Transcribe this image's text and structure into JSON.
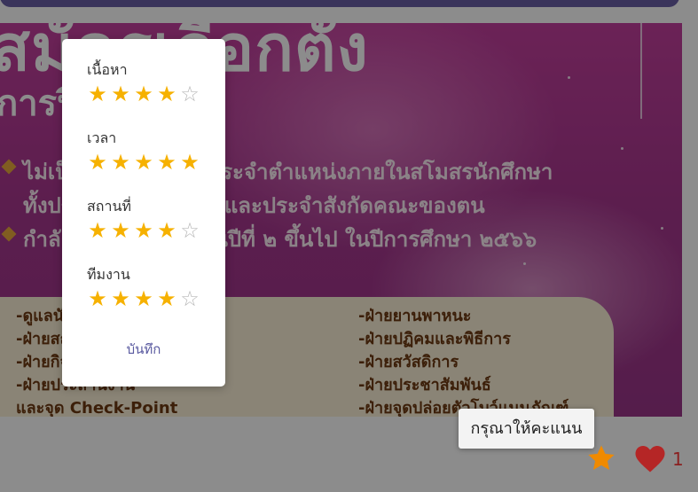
{
  "poster": {
    "headline": "สมัครเลือกตั้ง",
    "subhead": "การปี ๒๕๖๖",
    "lines": [
      "ไม่เป็นกรรมการหรือประจำตำแหน่งภายในสโมสรนักศึกษา",
      "ทั้งประจำมหาวิทยาลัยและประจำสังกัดคณะของตน",
      "กำลังศึกษาในระดับชั้นปีที่ ๒ ขึ้นไป ในปีการศึกษา ๒๕๖๖"
    ],
    "left_items": [
      "-ดูแลนักศึกษา",
      "-ฝ่ายสถานที่",
      "-ฝ่ายกิจกรรม",
      "-ฝ่ายประสานงาน",
      "และจุด Check-Point"
    ],
    "right_items": [
      "-ฝ่ายยานพาหนะ",
      "-ฝ่ายปฏิคมและพิธีการ",
      "-ฝ่ายสวัสดิการ",
      "-ฝ่ายประชาสัมพันธ์",
      "-ฝ่ายจุดปล่อยตัวโบว์แนนภัณฑ์"
    ],
    "colors": {
      "accent": "#e9a93c",
      "bg": "#a8378f",
      "panel": "#fbf0d8"
    }
  },
  "rating_popup": {
    "categories": [
      {
        "label": "เนื้อหา",
        "rating": 4,
        "max": 5
      },
      {
        "label": "เวลา",
        "rating": 5,
        "max": 5
      },
      {
        "label": "สถานที่",
        "rating": 4,
        "max": 5
      },
      {
        "label": "ทีมงาน",
        "rating": 4,
        "max": 5
      }
    ],
    "save_label": "บันทึก",
    "star_color": "#f6b100"
  },
  "tooltip": {
    "text": "กรุณาให้คะแนน"
  },
  "actions": {
    "rate_icon": "star-icon",
    "like_icon": "heart-icon",
    "like_count": "1",
    "like_color": "#b52626",
    "rate_color": "#f08a00"
  }
}
